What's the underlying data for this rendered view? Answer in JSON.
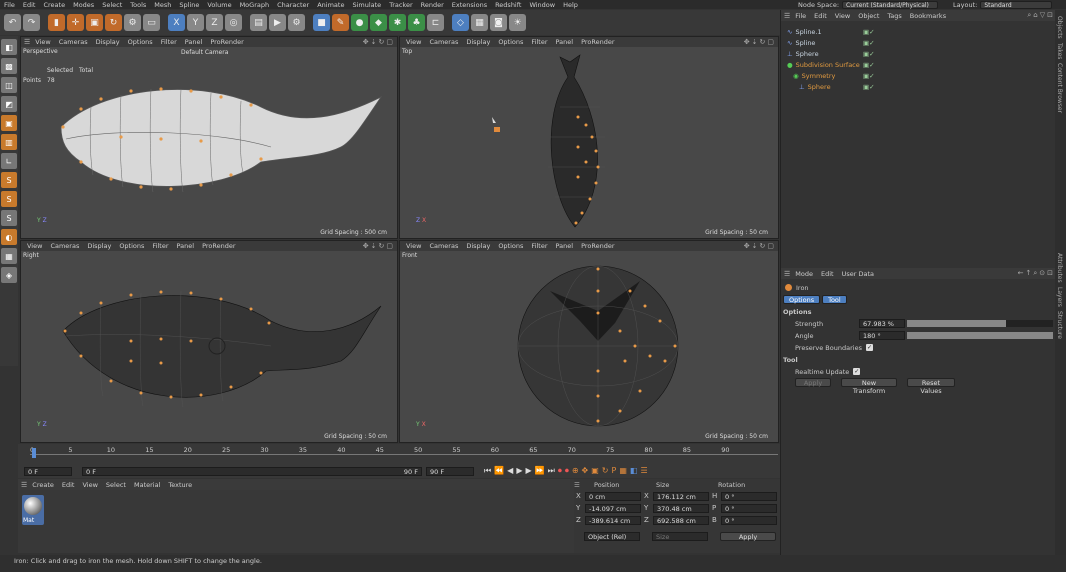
{
  "menu": [
    "File",
    "Edit",
    "Create",
    "Modes",
    "Select",
    "Tools",
    "Mesh",
    "Spline",
    "Volume",
    "MoGraph",
    "Character",
    "Animate",
    "Simulate",
    "Tracker",
    "Render",
    "Extensions",
    "Redshift",
    "Window",
    "Help"
  ],
  "node_space": {
    "label": "Node Space:",
    "value": "Current (Standard/Physical)"
  },
  "layout": {
    "label": "Layout:",
    "value": "Standard"
  },
  "viewport_menu": [
    "View",
    "Cameras",
    "Display",
    "Options",
    "Filter",
    "Panel",
    "ProRender"
  ],
  "viewports": {
    "perspective": {
      "name": "Perspective",
      "camera": "Default Camera",
      "selected_label": "Selected",
      "total_label": "Total",
      "points_label": "Points",
      "points_value": "78",
      "grid": "Grid Spacing : 500 cm"
    },
    "top": {
      "name": "Top",
      "grid": "Grid Spacing : 50 cm"
    },
    "right": {
      "name": "Right",
      "grid": "Grid Spacing : 50 cm"
    },
    "front": {
      "name": "Front",
      "grid": "Grid Spacing : 50 cm"
    }
  },
  "objects": {
    "menu": [
      "File",
      "Edit",
      "View",
      "Object",
      "Tags",
      "Bookmarks"
    ],
    "items": [
      {
        "name": "Spline.1",
        "color": "#c8d4e0"
      },
      {
        "name": "Spline",
        "color": "#c8d4e0"
      },
      {
        "name": "Sphere",
        "color": "#c8d4e0"
      },
      {
        "name": "Subdivision Surface",
        "color": "#e09a40"
      },
      {
        "name": "Symmetry",
        "color": "#e09a40"
      },
      {
        "name": "Sphere",
        "color": "#e09a40"
      }
    ]
  },
  "attributes": {
    "menu": [
      "Mode",
      "Edit",
      "User Data"
    ],
    "tool_name": "Iron",
    "tabs": [
      "Options",
      "Tool"
    ],
    "options_header": "Options",
    "strength_label": "Strength",
    "strength_value": "67.983 %",
    "strength_fraction": 0.68,
    "angle_label": "Angle",
    "angle_value": "180 °",
    "preserve_label": "Preserve Boundaries",
    "tool_header": "Tool",
    "realtime_label": "Realtime Update",
    "apply": "Apply",
    "new_transform": "New Transform",
    "reset_values": "Reset Values"
  },
  "side_tabs_top": [
    "Objects",
    "Takes",
    "Content Browser"
  ],
  "side_tabs_bottom": [
    "Attributes",
    "Layers",
    "Structure"
  ],
  "timeline": {
    "ticks": [
      "0",
      "5",
      "10",
      "15",
      "20",
      "25",
      "30",
      "35",
      "40",
      "45",
      "50",
      "55",
      "60",
      "65",
      "70",
      "75",
      "80",
      "85",
      "90"
    ],
    "current_frame": "0 F",
    "start": "0 F",
    "preview_start": "0 F",
    "preview_end": "90 F",
    "end": "90 F",
    "end_frame_field": "0 F"
  },
  "material": {
    "menu": [
      "Create",
      "Edit",
      "View",
      "Select",
      "Material",
      "Texture"
    ],
    "mat_name": "Mat"
  },
  "coords": {
    "headers": [
      "Position",
      "Size",
      "Rotation"
    ],
    "rows": [
      {
        "a": "X",
        "pos": "0 cm",
        "b": "X",
        "size": "176.112 cm",
        "c": "H",
        "rot": "0 °"
      },
      {
        "a": "Y",
        "pos": "-14.097 cm",
        "b": "Y",
        "size": "370.48 cm",
        "c": "P",
        "rot": "0 °"
      },
      {
        "a": "Z",
        "pos": "-389.614 cm",
        "b": "Z",
        "size": "692.588 cm",
        "c": "B",
        "rot": "0 °"
      }
    ],
    "mode": "Object (Rel)",
    "size_mode": "Size",
    "apply": "Apply"
  },
  "status": "Iron: Click and drag to iron the mesh. Hold down SHIFT to change the angle.",
  "colors": {
    "accent": "#e08a3c",
    "points": "#e89a48",
    "selection_blue": "#5a8dd6"
  }
}
